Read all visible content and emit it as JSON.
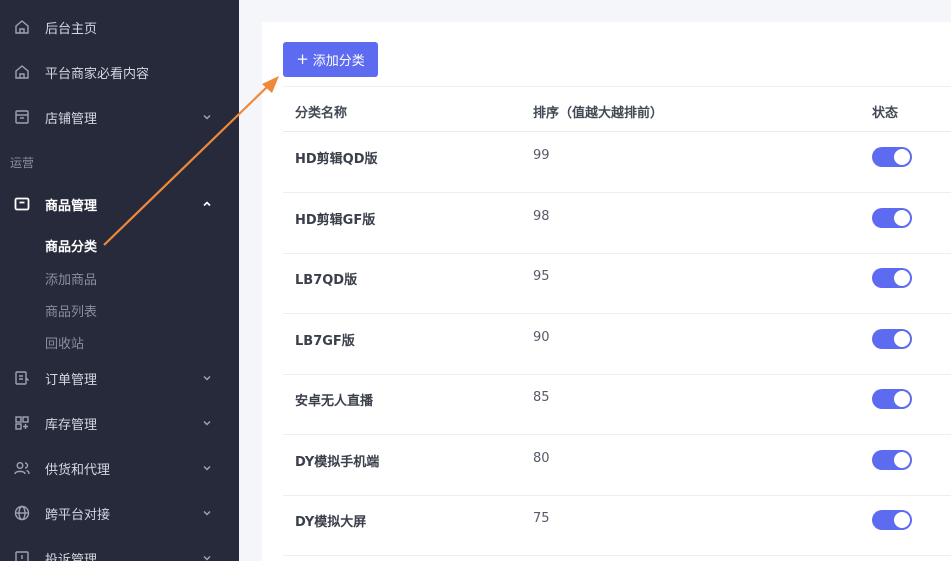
{
  "sidebar": {
    "items": [
      {
        "label": "后台主页",
        "icon": "home-icon"
      },
      {
        "label": "平台商家必看内容",
        "icon": "home-icon"
      },
      {
        "label": "店铺管理",
        "icon": "store-icon"
      },
      {
        "label": "商品管理",
        "icon": "box-icon"
      },
      {
        "label": "订单管理",
        "icon": "order-icon"
      },
      {
        "label": "库存管理",
        "icon": "grid-icon"
      },
      {
        "label": "供货和代理",
        "icon": "users-icon"
      },
      {
        "label": "跨平台对接",
        "icon": "globe-icon"
      },
      {
        "label": "投诉管理",
        "icon": "complaint-icon"
      }
    ],
    "section_label": "运营",
    "sub_items": [
      "商品分类",
      "添加商品",
      "商品列表",
      "回收站"
    ]
  },
  "toolbar": {
    "add_label": "添加分类"
  },
  "table": {
    "columns": [
      "分类名称",
      "排序（值越大越排前）",
      "状态"
    ],
    "rows": [
      {
        "name": "HD剪辑QD版",
        "sort": "99",
        "enabled": true
      },
      {
        "name": "HD剪辑GF版",
        "sort": "98",
        "enabled": true
      },
      {
        "name": "LB7QD版",
        "sort": "95",
        "enabled": true
      },
      {
        "name": "LB7GF版",
        "sort": "90",
        "enabled": true
      },
      {
        "name": "安卓无人直播",
        "sort": "85",
        "enabled": true
      },
      {
        "name": "DY模拟手机端",
        "sort": "80",
        "enabled": true
      },
      {
        "name": "DY模拟大屏",
        "sort": "75",
        "enabled": true
      }
    ]
  },
  "colors": {
    "sidebar_bg": "#262a3b",
    "accent": "#5c6bef",
    "annotation_arrow": "#f0883a"
  }
}
